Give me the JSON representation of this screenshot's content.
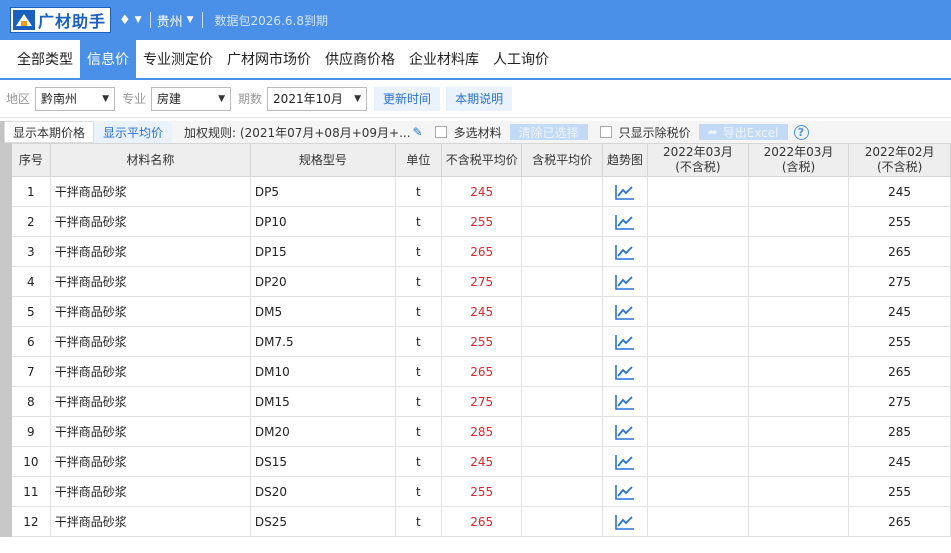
{
  "app": {
    "title": "广材助手",
    "region": "贵州",
    "plan": "数据包2026.6.8到期"
  },
  "nav": {
    "tabs": [
      "全部类型",
      "信息价",
      "专业测定价",
      "广材网市场价",
      "供应商价格",
      "企业材料库",
      "人工询价"
    ],
    "active_index": 1
  },
  "filters": {
    "area_label": "地区",
    "area_value": "黔南州",
    "major_label": "专业",
    "major_value": "房建",
    "period_label": "期数",
    "period_value": "2021年10月",
    "update_button": "更新时间",
    "note_button": "本期说明"
  },
  "options": {
    "tab_current": "显示本期价格",
    "tab_average": "显示平均价",
    "weight_rule": "加权规则: (2021年07月+08月+09月+...",
    "multi_select": "多选材料",
    "clear_button": "清除已选择",
    "tax_excluded_only": "只显示除税价",
    "export_button": "导出Excel",
    "help": "?"
  },
  "table": {
    "headers": [
      "序号",
      "材料名称",
      "规格型号",
      "单位",
      "不含税平均价",
      "含税平均价",
      "趋势图",
      "2022年03月\n(不含税)",
      "2022年03月\n(含税)",
      "2022年02月\n(不含税)"
    ],
    "rows": [
      {
        "no": "1",
        "name": "干拌商品砂浆",
        "spec": "DP5",
        "unit": "t",
        "avg_ex": "245",
        "avg_in": "",
        "m1": "",
        "m2": "",
        "m3": "245"
      },
      {
        "no": "2",
        "name": "干拌商品砂浆",
        "spec": "DP10",
        "unit": "t",
        "avg_ex": "255",
        "avg_in": "",
        "m1": "",
        "m2": "",
        "m3": "255"
      },
      {
        "no": "3",
        "name": "干拌商品砂浆",
        "spec": "DP15",
        "unit": "t",
        "avg_ex": "265",
        "avg_in": "",
        "m1": "",
        "m2": "",
        "m3": "265"
      },
      {
        "no": "4",
        "name": "干拌商品砂浆",
        "spec": "DP20",
        "unit": "t",
        "avg_ex": "275",
        "avg_in": "",
        "m1": "",
        "m2": "",
        "m3": "275"
      },
      {
        "no": "5",
        "name": "干拌商品砂浆",
        "spec": "DM5",
        "unit": "t",
        "avg_ex": "245",
        "avg_in": "",
        "m1": "",
        "m2": "",
        "m3": "245"
      },
      {
        "no": "6",
        "name": "干拌商品砂浆",
        "spec": "DM7.5",
        "unit": "t",
        "avg_ex": "255",
        "avg_in": "",
        "m1": "",
        "m2": "",
        "m3": "255"
      },
      {
        "no": "7",
        "name": "干拌商品砂浆",
        "spec": "DM10",
        "unit": "t",
        "avg_ex": "265",
        "avg_in": "",
        "m1": "",
        "m2": "",
        "m3": "265"
      },
      {
        "no": "8",
        "name": "干拌商品砂浆",
        "spec": "DM15",
        "unit": "t",
        "avg_ex": "275",
        "avg_in": "",
        "m1": "",
        "m2": "",
        "m3": "275"
      },
      {
        "no": "9",
        "name": "干拌商品砂浆",
        "spec": "DM20",
        "unit": "t",
        "avg_ex": "285",
        "avg_in": "",
        "m1": "",
        "m2": "",
        "m3": "285"
      },
      {
        "no": "10",
        "name": "干拌商品砂浆",
        "spec": "DS15",
        "unit": "t",
        "avg_ex": "245",
        "avg_in": "",
        "m1": "",
        "m2": "",
        "m3": "245"
      },
      {
        "no": "11",
        "name": "干拌商品砂浆",
        "spec": "DS20",
        "unit": "t",
        "avg_ex": "255",
        "avg_in": "",
        "m1": "",
        "m2": "",
        "m3": "255"
      },
      {
        "no": "12",
        "name": "干拌商品砂浆",
        "spec": "DS25",
        "unit": "t",
        "avg_ex": "265",
        "avg_in": "",
        "m1": "",
        "m2": "",
        "m3": "265"
      }
    ]
  },
  "colors": {
    "accent": "#4a90e8",
    "price_red": "#e0252c",
    "link_blue": "#2a72d6"
  },
  "icons": {
    "title_bar": [
      "logo",
      "diamond-icon",
      "caret-down-icon"
    ],
    "trend": "trend-chart-icon",
    "edit": "pencil-icon",
    "help": "help-icon"
  }
}
